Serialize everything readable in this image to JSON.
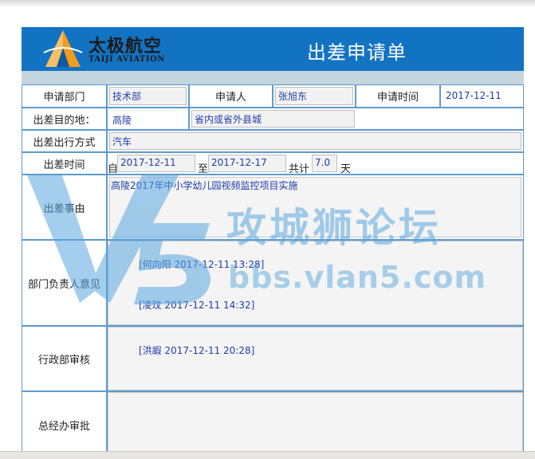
{
  "header": {
    "logo_cn": "太极航空",
    "logo_en": "TAIJI AVIATION",
    "title": "出差申请单"
  },
  "row1": {
    "dept_label": "申请部门",
    "dept_value": "技术部",
    "applicant_label": "申请人",
    "applicant_value": "张旭东",
    "time_label": "申请时间",
    "time_value": "2017-12-11"
  },
  "row2": {
    "dest_label": "出差目的地：",
    "dest_value": "高陵",
    "dest_scope": "省内或省外县城"
  },
  "row3": {
    "transport_label": "出差出行方式",
    "transport_value": "汽车"
  },
  "row4": {
    "period_label": "出差时间",
    "from_label": "自",
    "from_value": "2017-12-11",
    "to_label": "至",
    "to_value": "2017-12-17",
    "total_label": "共计",
    "total_value": "7.0",
    "unit_label": "天"
  },
  "row5": {
    "reason_label": "出差事由",
    "reason_value": "高陵2017年中小学幼儿园视频监控项目实施"
  },
  "row6": {
    "dept_opinion_label": "部门负责人意见",
    "opinions": [
      "[何向阳 2017-12-11 13:28]",
      "[凌玟 2017-12-11 14:32]"
    ]
  },
  "row7": {
    "admin_label": "行政部审核",
    "admin_value": "[洪嘏 2017-12-11 20:28]"
  },
  "row8": {
    "gm_label": "总经办审批"
  },
  "watermark": {
    "text_cn": "攻城狮论坛",
    "text_url": "bbs.vlan5.com",
    "color": "#5aa7e0"
  },
  "colors": {
    "header_bg": "#1373c3",
    "border": "#5c9bcf",
    "value_text": "#1e3ea8"
  }
}
